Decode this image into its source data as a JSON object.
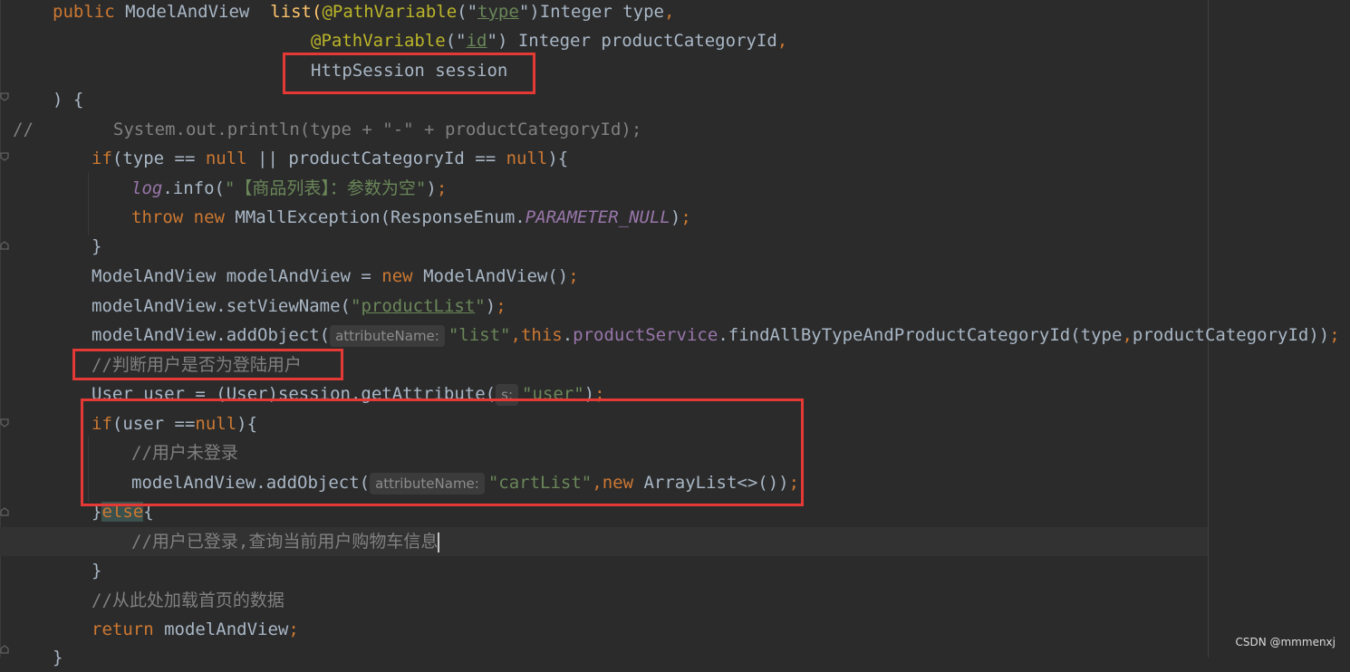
{
  "code": {
    "l1": {
      "kw_public": "public",
      "type_mav": " ModelAndView  ",
      "method": "list(",
      "ann1": "@PathVariable",
      "p1": "(\"",
      "s1": "type",
      "p2": "\")Integer type",
      "comma": ","
    },
    "l2": {
      "ann": "@PathVariable",
      "p1": "(\"",
      "s": "id",
      "p2": "\") Integer productCategoryId",
      "comma": ","
    },
    "l3": {
      "text": "HttpSession session"
    },
    "l4": {
      "text": ") {"
    },
    "l5": {
      "prefix": "//",
      "text": "System.out.println(type + \"-\" + productCategoryId);"
    },
    "l6": {
      "kw_if": "if",
      "a": "(type == ",
      "kw_null1": "null",
      "b": " || productCategoryId == ",
      "kw_null2": "null",
      "c": "){"
    },
    "l7": {
      "log": "log",
      "a": ".info(",
      "s": "\"【商品列表】：参数为空\"",
      "b": ")",
      "semi": ";"
    },
    "l8": {
      "kw_throw": "throw",
      "sp": " ",
      "kw_new": "new",
      "a": " MMallException(ResponseEnum.",
      "const": "PARAMETER_NULL",
      "b": ")",
      "semi": ";"
    },
    "l9": {
      "text": "}"
    },
    "l10": {
      "a": "ModelAndView modelAndView = ",
      "kw_new": "new",
      "b": " ModelAndView()",
      "semi": ";"
    },
    "l11": {
      "a": "modelAndView.setViewName(",
      "q1": "\"",
      "s": "productList",
      "q2": "\"",
      "b": ")",
      "semi": ";"
    },
    "l12": {
      "a": "modelAndView.addObject(",
      "hint": "attributeName:",
      "s": "\"list\"",
      "comma": ",",
      "kw_this": "this",
      "dot": ".",
      "fld": "productService",
      "b": ".findAllByTypeAndProductCategoryId(type",
      "comma2": ",",
      "c": "productCategoryId))",
      "semi": ";"
    },
    "l13": {
      "text": "//判断用户是否为登陆用户"
    },
    "l14": {
      "a": "User user = (User)session.getAttribute(",
      "hint": "s:",
      "s": "\"user\"",
      "b": ")",
      "semi": ";"
    },
    "l15": {
      "kw_if": "if",
      "a": "(user ==",
      "kw_null": "null",
      "b": "){"
    },
    "l16": {
      "text": "//用户未登录"
    },
    "l17": {
      "a": "modelAndView.addObject(",
      "hint": "attributeName:",
      "s": "\"cartList\"",
      "comma": ",",
      "kw_new": "new",
      "b": " ArrayList<>())",
      "semi": ";"
    },
    "l18": {
      "a": "}",
      "kw_else": "else",
      "b": "{"
    },
    "l19": {
      "text": "//用户已登录,查询当前用户购物车信息"
    },
    "l20": {
      "text": "}"
    },
    "l21": {
      "text": "//从此处加载首页的数据"
    },
    "l22": {
      "kw_return": "return",
      "a": " modelAndView",
      "semi": ";"
    },
    "l23": {
      "text": "}"
    }
  },
  "watermark": "CSDN @mmmenxj",
  "colors": {
    "background": "#2b2b2b",
    "keyword": "#cc7832",
    "string": "#6a8759",
    "comment": "#808080",
    "annotation": "#bbb529",
    "field": "#9876aa",
    "default": "#a9b7c6",
    "highlight_box": "#e53935"
  }
}
